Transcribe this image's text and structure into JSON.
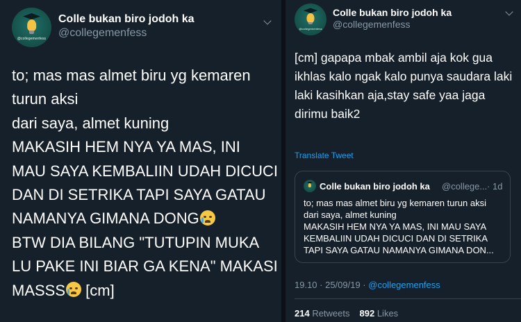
{
  "account": {
    "name": "Colle bukan biro jodoh ka",
    "handle": "@collegemenfess",
    "avatar_text": "@collegemenfess",
    "avatar_icon": "lightbulb-graduation-cap-icon"
  },
  "left_tweet": {
    "text": "to; mas mas almet biru yg kemaren\nturun aksi\ndari saya, almet kuning\nMAKASIH HEM NYA YA MAS, INI\nMAU SAYA KEMBALIIN UDAH DICUCI\nDAN DI SETRIKA TAPI SAYA GATAU\nNAMANYA GIMANA DONG",
    "text_part2": "\nBTW DIA BILANG \"TUTUPIN MUKA\nLU PAKE INI BIAR GA KENA\" MAKASI\nMASSS",
    "text_part3": " [cm]"
  },
  "right_tweet": {
    "text": "[cm] gapapa mbak ambil aja kok gua ikhlas kalo ngak kalo punya saudara laki laki kasihkan aja,stay safe yaa jaga dirimu baik2",
    "translate_label": "Translate Tweet",
    "quote": {
      "name": "Colle bukan biro jodoh ka",
      "handle": "@college...",
      "separator": "·",
      "time": "1d",
      "text": "to; mas mas almet biru yg kemaren turun aksi\ndari saya, almet kuning\nMAKASIH HEM NYA YA MAS, INI MAU SAYA\nKEMBALIIN UDAH DICUCI DAN DI SETRIKA\nTAPI SAYA GATAU NAMANYA GIMANA DON..."
    },
    "timestamp": "19.10 · 25/09/19 · ",
    "source_link": "@collegemenfess",
    "retweets_count": "214",
    "retweets_label": " Retweets",
    "likes_count": "892",
    "likes_label": " Likes"
  },
  "colors": {
    "background": "#15202b",
    "link": "#1da1f2",
    "secondary_text": "#8899a6",
    "border": "#38444d"
  },
  "icons": [
    "chevron-down-icon",
    "loudly-crying-face-icon"
  ]
}
